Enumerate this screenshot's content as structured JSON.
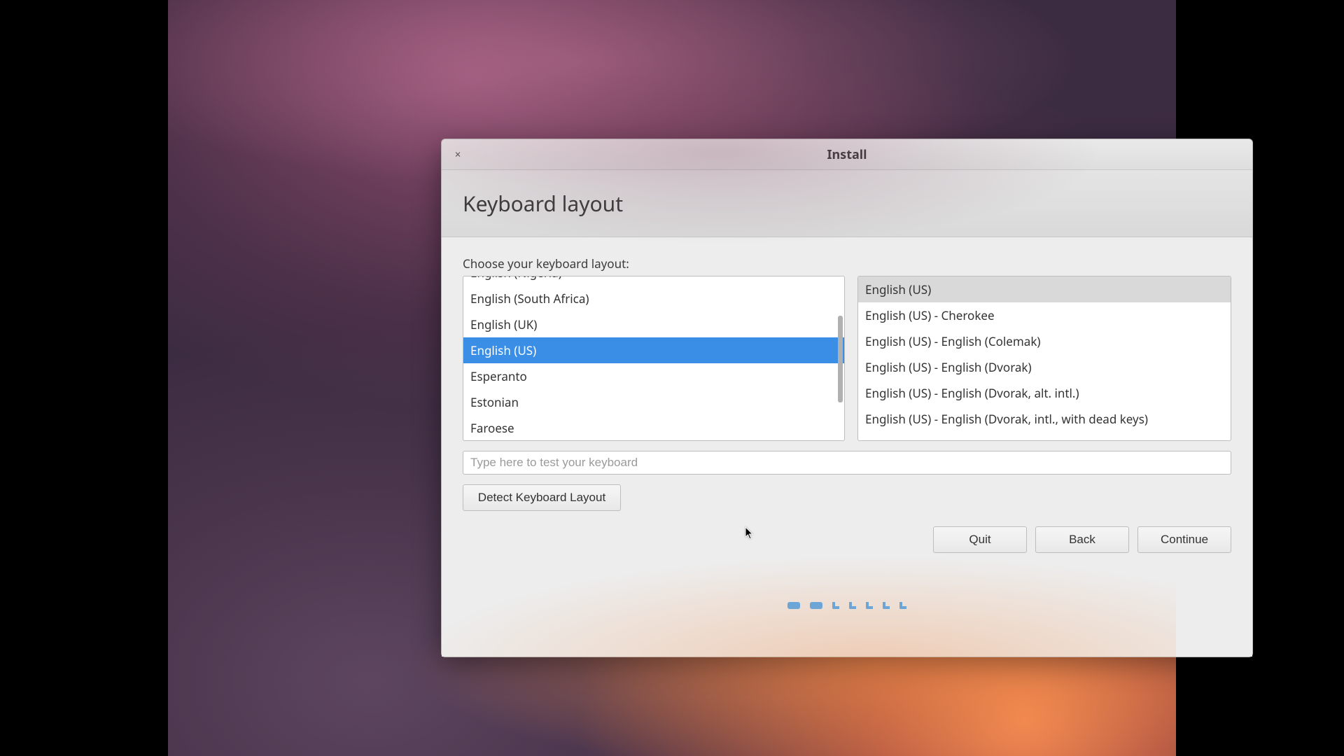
{
  "window": {
    "title": "Install",
    "close_glyph": "×"
  },
  "page": {
    "heading": "Keyboard layout",
    "choose_label": "Choose your keyboard layout:"
  },
  "layouts": [
    {
      "label": "English (Nigeria)",
      "selected": false,
      "clip_top": true
    },
    {
      "label": "English (South Africa)",
      "selected": false,
      "clip_top": false
    },
    {
      "label": "English (UK)",
      "selected": false,
      "clip_top": false
    },
    {
      "label": "English (US)",
      "selected": true,
      "clip_top": false
    },
    {
      "label": "Esperanto",
      "selected": false,
      "clip_top": false
    },
    {
      "label": "Estonian",
      "selected": false,
      "clip_top": false
    },
    {
      "label": "Faroese",
      "selected": false,
      "clip_top": false
    }
  ],
  "variants": [
    {
      "label": "English (US)",
      "selected": true
    },
    {
      "label": "English (US) - Cherokee",
      "selected": false
    },
    {
      "label": "English (US) - English (Colemak)",
      "selected": false
    },
    {
      "label": "English (US) - English (Dvorak)",
      "selected": false
    },
    {
      "label": "English (US) - English (Dvorak, alt. intl.)",
      "selected": false
    },
    {
      "label": "English (US) - English (Dvorak, intl., with dead keys)",
      "selected": false
    }
  ],
  "test_input": {
    "placeholder": "Type here to test your keyboard",
    "value": ""
  },
  "buttons": {
    "detect": "Detect Keyboard Layout",
    "quit": "Quit",
    "back": "Back",
    "continue": "Continue"
  },
  "progress": {
    "total": 7,
    "done": 2
  }
}
